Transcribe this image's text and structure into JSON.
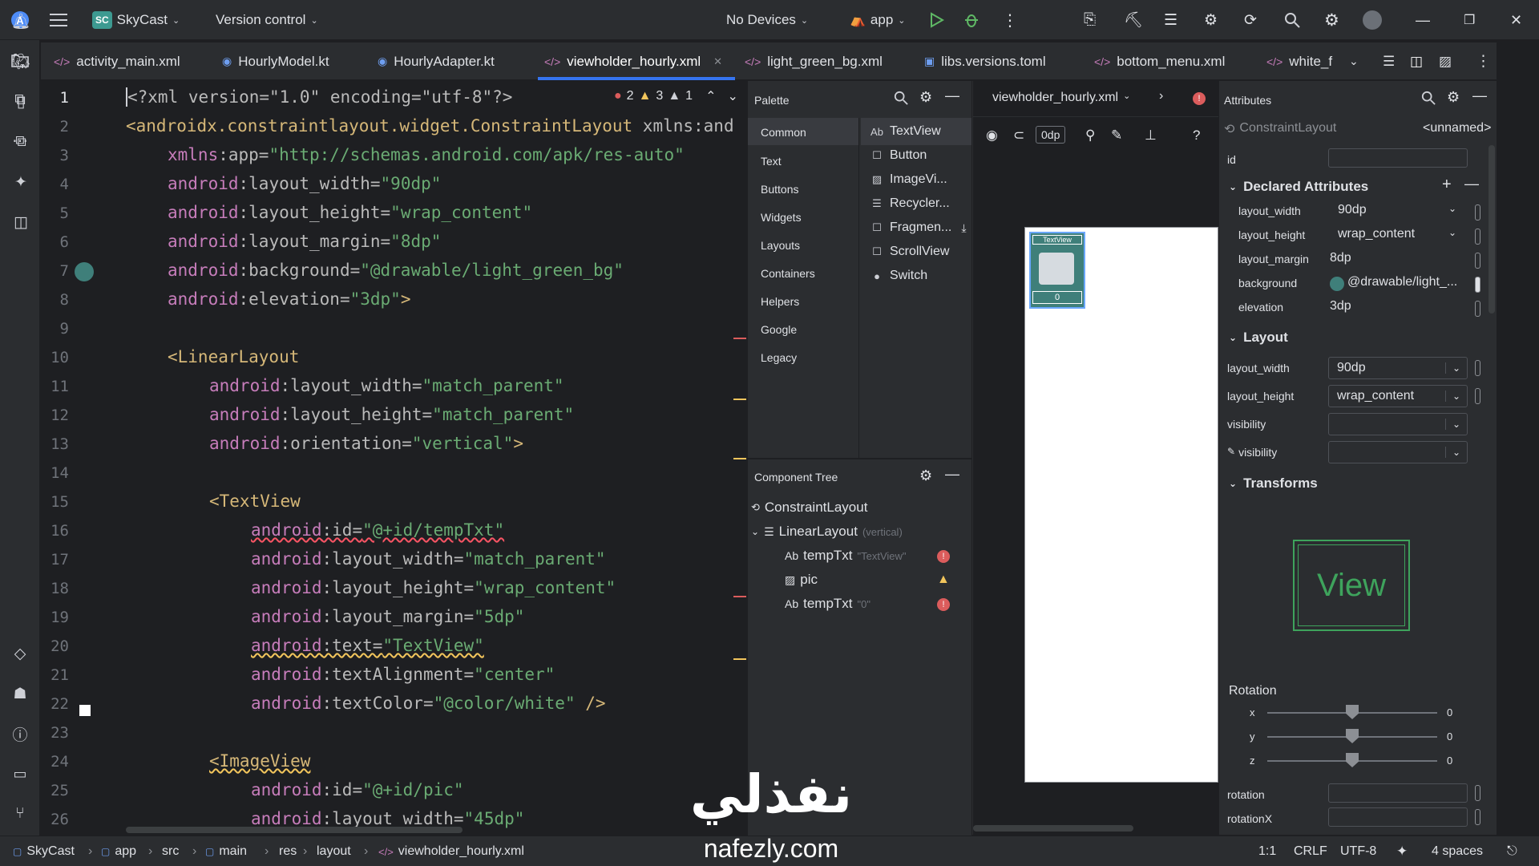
{
  "topbar": {
    "project_badge": "SC",
    "project_name": "SkyCast",
    "version_control": "Version control",
    "devices": "No Devices",
    "run_config": "app"
  },
  "tabs": [
    {
      "label": "activity_main.xml"
    },
    {
      "label": "HourlyModel.kt"
    },
    {
      "label": "HourlyAdapter.kt"
    },
    {
      "label": "viewholder_hourly.xml"
    },
    {
      "label": "light_green_bg.xml"
    },
    {
      "label": "libs.versions.toml"
    },
    {
      "label": "bottom_menu.xml"
    },
    {
      "label": "white_f"
    }
  ],
  "inspections": {
    "errors": "2",
    "warnings": "3",
    "weak_warnings": "1"
  },
  "line_numbers": [
    "1",
    "2",
    "3",
    "4",
    "5",
    "6",
    "7",
    "8",
    "9",
    "10",
    "11",
    "12",
    "13",
    "14",
    "15",
    "16",
    "17",
    "18",
    "19",
    "20",
    "21",
    "22",
    "23",
    "24",
    "25",
    "26"
  ],
  "code": {
    "l1": {
      "a": "<?xml version=\"1.0\" encoding=\"utf-8\"?>"
    },
    "l2": {
      "tag": "<androidx.constraintlayout.widget.ConstraintLayout",
      "rest": " xmlns:and"
    },
    "l3": {
      "ns": "xmlns",
      "attr": ":app=",
      "val": "\"http://schemas.android.com/apk/res-auto\""
    },
    "l4": {
      "ns": "android",
      "attr": ":layout_width=",
      "val": "\"90dp\""
    },
    "l5": {
      "ns": "android",
      "attr": ":layout_height=",
      "val": "\"wrap_content\""
    },
    "l6": {
      "ns": "android",
      "attr": ":layout_margin=",
      "val": "\"8dp\""
    },
    "l7": {
      "ns": "android",
      "attr": ":background=",
      "val": "\"@drawable/light_green_bg\""
    },
    "l8": {
      "ns": "android",
      "attr": ":elevation=",
      "val": "\"3dp\"",
      "end": ">"
    },
    "l10": {
      "tag": "<LinearLayout"
    },
    "l11": {
      "ns": "android",
      "attr": ":layout_width=",
      "val": "\"match_parent\""
    },
    "l12": {
      "ns": "android",
      "attr": ":layout_height=",
      "val": "\"match_parent\""
    },
    "l13": {
      "ns": "android",
      "attr": ":orientation=",
      "val": "\"vertical\"",
      "end": ">"
    },
    "l15": {
      "tag": "<TextView"
    },
    "l16": {
      "ns": "android",
      "attr": ":id=",
      "val": "\"@+id/tempTxt\""
    },
    "l17": {
      "ns": "android",
      "attr": ":layout_width=",
      "val": "\"match_parent\""
    },
    "l18": {
      "ns": "android",
      "attr": ":layout_height=",
      "val": "\"wrap_content\""
    },
    "l19": {
      "ns": "android",
      "attr": ":layout_margin=",
      "val": "\"5dp\""
    },
    "l20": {
      "ns": "android",
      "attr": ":text=",
      "val": "\"TextView\""
    },
    "l21": {
      "ns": "android",
      "attr": ":textAlignment=",
      "val": "\"center\""
    },
    "l22": {
      "ns": "android",
      "attr": ":textColor=",
      "val": "\"@color/white\"",
      "end": " />"
    },
    "l24": {
      "tag": "<ImageView"
    },
    "l25": {
      "ns": "android",
      "attr": ":id=",
      "val": "\"@+id/pic\""
    },
    "l26": {
      "ns": "android",
      "attr": ":layout_width=",
      "val": "\"45dp\""
    }
  },
  "palette": {
    "title": "Palette",
    "categories": [
      "Common",
      "Text",
      "Buttons",
      "Widgets",
      "Layouts",
      "Containers",
      "Helpers",
      "Google",
      "Legacy"
    ],
    "items": [
      {
        "icon": "Ab",
        "label": "TextView"
      },
      {
        "icon": "☐",
        "label": "Button"
      },
      {
        "icon": "▨",
        "label": "ImageVi..."
      },
      {
        "icon": "☰",
        "label": "Recycler..."
      },
      {
        "icon": "☐",
        "label": "Fragmen..."
      },
      {
        "icon": "☐",
        "label": "ScrollView"
      },
      {
        "icon": "●",
        "label": "Switch"
      }
    ]
  },
  "component_tree": {
    "title": "Component Tree",
    "rows": [
      {
        "label": "ConstraintLayout",
        "sub": ""
      },
      {
        "label": "LinearLayout",
        "sub": "(vertical)"
      },
      {
        "label": "tempTxt",
        "sub": "\"TextView\""
      },
      {
        "label": "pic",
        "sub": ""
      },
      {
        "label": "tempTxt",
        "sub": "\"0\""
      }
    ]
  },
  "design": {
    "file": "viewholder_hourly.xml",
    "margin": "0dp",
    "preview_text": "TextView",
    "preview_value": "0"
  },
  "attributes": {
    "title": "Attributes",
    "component": "ConstraintLayout",
    "component_name": "<unnamed>",
    "id_label": "id",
    "declared_title": "Declared Attributes",
    "declared": [
      {
        "name": "layout_width",
        "value": "90dp"
      },
      {
        "name": "layout_height",
        "value": "wrap_content"
      },
      {
        "name": "layout_margin",
        "value": "8dp"
      },
      {
        "name": "background",
        "value": "@drawable/light_..."
      },
      {
        "name": "elevation",
        "value": "3dp"
      }
    ],
    "layout_title": "Layout",
    "layout": [
      {
        "name": "layout_width",
        "value": "90dp"
      },
      {
        "name": "layout_height",
        "value": "wrap_content"
      },
      {
        "name": "visibility",
        "value": ""
      },
      {
        "name": "visibility",
        "value": ""
      }
    ],
    "transforms_title": "Transforms",
    "view_preview": "View",
    "rotation_title": "Rotation",
    "rotation_axes": [
      {
        "axis": "x",
        "value": "0"
      },
      {
        "axis": "y",
        "value": "0"
      },
      {
        "axis": "z",
        "value": "0"
      }
    ],
    "rotation_fields": [
      "rotation",
      "rotationX"
    ]
  },
  "statusbar": {
    "breadcrumb": [
      "SkyCast",
      "app",
      "src",
      "main",
      "res",
      "layout",
      "viewholder_hourly.xml"
    ],
    "position": "1:1",
    "line_sep": "CRLF",
    "encoding": "UTF-8",
    "indent": "4 spaces"
  },
  "watermark": {
    "arabic": "نفذلي",
    "latin": "nafezly.com"
  },
  "colors": {
    "accent": "#3574f0",
    "error": "#db5c5c",
    "warning": "#f2c55c",
    "green": "#5fb865"
  }
}
